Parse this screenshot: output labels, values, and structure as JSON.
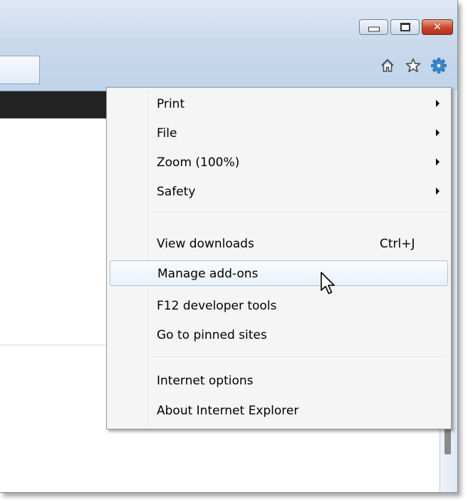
{
  "window": {
    "controls": {
      "minimize_icon": "minimize-icon",
      "maximize_icon": "maximize-icon",
      "close_icon": "close-icon",
      "close_color": "#c9442a"
    },
    "toolbar_icons": [
      "home-icon",
      "favorites-star-icon",
      "tools-gear-icon"
    ],
    "gear_color": "#3a8fd6"
  },
  "menu": {
    "groups": [
      [
        {
          "label": "Print",
          "submenu": true
        },
        {
          "label": "File",
          "submenu": true
        },
        {
          "label": "Zoom (100%)",
          "submenu": true
        },
        {
          "label": "Safety",
          "submenu": true
        }
      ],
      [
        {
          "label": "View downloads",
          "shortcut": "Ctrl+J"
        },
        {
          "label": "Manage add-ons",
          "hovered": true
        },
        {
          "label": "F12 developer tools"
        },
        {
          "label": "Go to pinned sites"
        }
      ],
      [
        {
          "label": "Internet options"
        },
        {
          "label": "About Internet Explorer"
        }
      ]
    ],
    "hover_highlight_color": "#a8c2e0"
  }
}
